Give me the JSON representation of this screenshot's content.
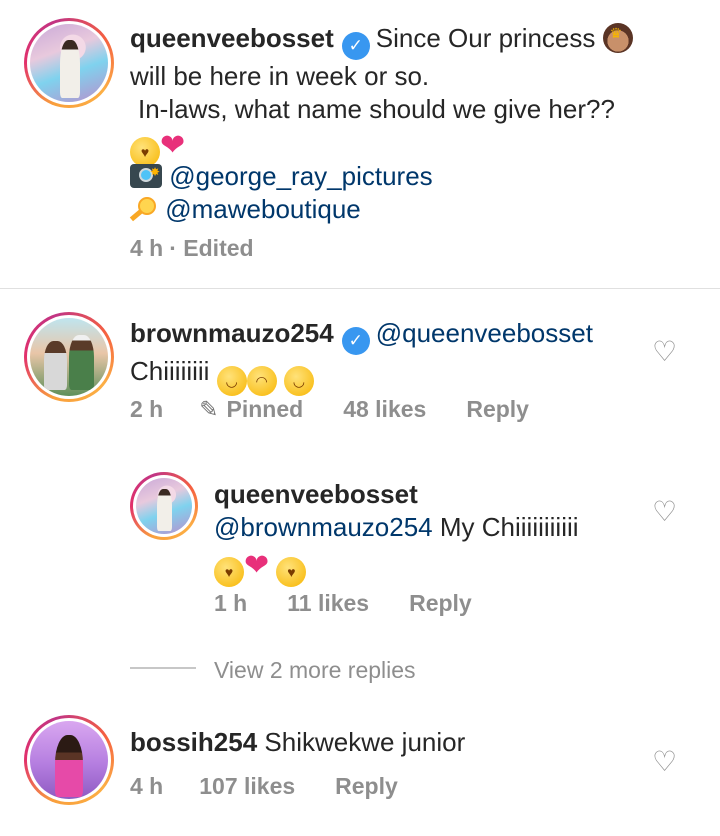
{
  "caption": {
    "username": "queenveebosset",
    "line1": "Since Our princess",
    "line2": "will be here in week or so.",
    "line3": "In-laws, what name should we give her??",
    "photo_credit": "@george_ray_pictures",
    "boutique": "@maweboutique",
    "time": "4 h",
    "edited": "· Edited"
  },
  "comments": [
    {
      "username": "brownmauzo254",
      "mention": "@queenveebosset",
      "text": "Chiiiiiiii",
      "time": "2 h",
      "pinned": "Pinned",
      "likes": "48 likes",
      "reply": "Reply",
      "replies": [
        {
          "username": "queenveebosset",
          "mention": "@brownmauzo254",
          "text": "My Chiiiiiiiiiii",
          "time": "1 h",
          "likes": "11 likes",
          "reply": "Reply"
        }
      ],
      "view_more": "View 2 more replies"
    },
    {
      "username": "bossih254",
      "text": "Shikwekwe junior",
      "time": "4 h",
      "likes": "107 likes",
      "reply": "Reply"
    }
  ],
  "icons": {
    "verified": "verified-badge-icon",
    "like": "heart-outline-icon",
    "pin": "pin-icon",
    "camera": "camera-icon",
    "pacifier": "pacifier-icon"
  },
  "colors": {
    "verified": "#3897f0",
    "mention": "#00376b",
    "meta": "#8e8e8e"
  }
}
